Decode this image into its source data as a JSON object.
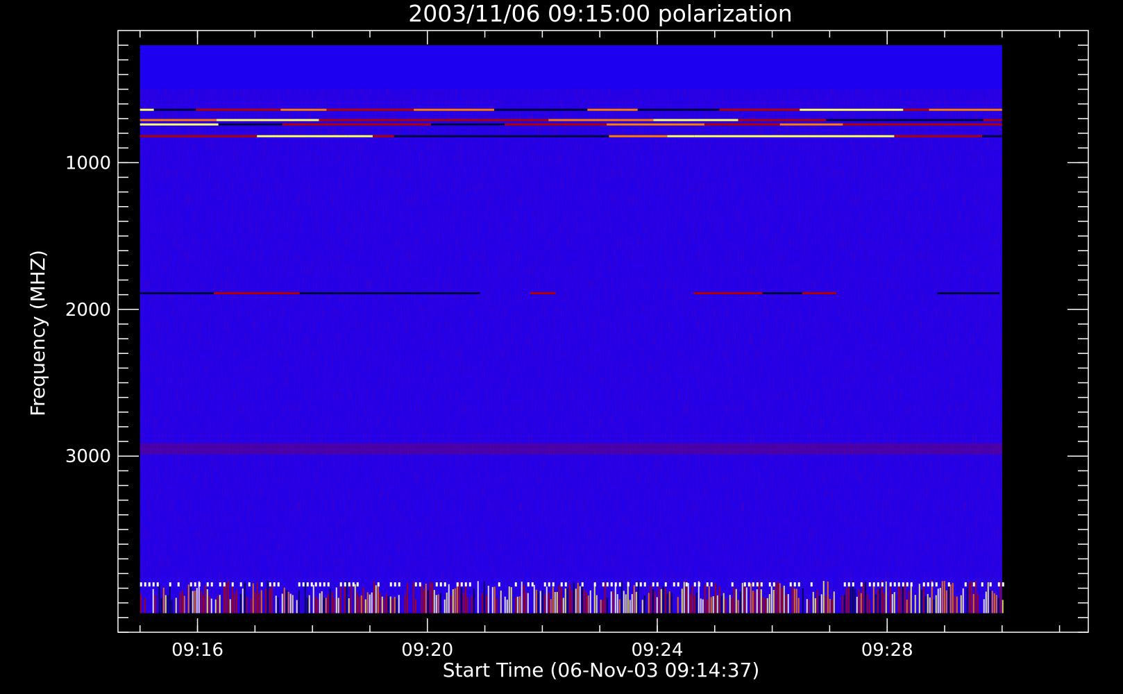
{
  "chart_data": {
    "type": "heatmap",
    "title": "2003/11/06 09:15:00 polarization",
    "xlabel": "Start Time (06-Nov-03 09:14:37)",
    "ylabel": "Frequency (MHZ)",
    "x_range": [
      "09:14:37",
      "09:31:30"
    ],
    "x_ticks": [
      "09:16",
      "09:20",
      "09:24",
      "09:28"
    ],
    "ylim": [
      4200,
      100
    ],
    "y_axis_inverted": true,
    "y_ticks": [
      1000,
      2000,
      3000
    ],
    "data_time_range": [
      "09:15:00",
      "09:30:00"
    ],
    "data_freq_range_mhz": [
      200,
      4070
    ],
    "background_color": "#1e00f0",
    "colormap": [
      "#000040",
      "#1e00f0",
      "#b00000",
      "#ff7a00",
      "#ffff60",
      "#ffffff"
    ],
    "features": [
      {
        "freq_mhz": 200,
        "to_freq_mhz": 500,
        "description": "flat background band"
      },
      {
        "freq_mhz": 640,
        "type": "horizontal streak"
      },
      {
        "freq_mhz": 710,
        "type": "horizontal streak"
      },
      {
        "freq_mhz": 740,
        "type": "horizontal streak"
      },
      {
        "freq_mhz": 820,
        "type": "horizontal streak"
      },
      {
        "freq_mhz": 1890,
        "type": "intermittent horizontal streak"
      },
      {
        "freq_mhz": 2950,
        "type": "faint band"
      },
      {
        "freq_mhz": 3850,
        "to_freq_mhz": 4070,
        "type": "noisy vertical-striped band"
      }
    ]
  }
}
